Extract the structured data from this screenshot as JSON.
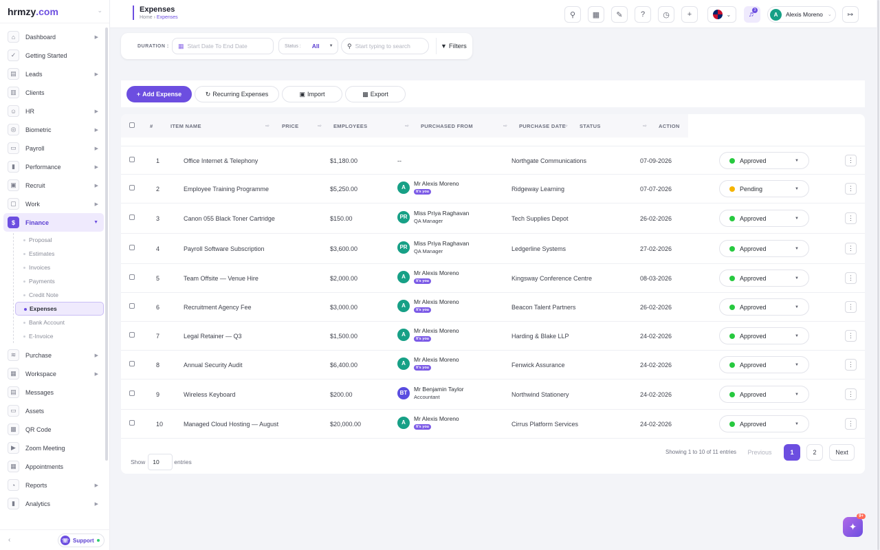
{
  "app": {
    "logo_text": "hrmzy",
    "logo_suffix": ".com"
  },
  "sidebar": {
    "items": [
      {
        "label": "Dashboard",
        "icon": "home-icon",
        "arrow": true
      },
      {
        "label": "Getting Started",
        "icon": "check-circle-icon",
        "arrow": false
      },
      {
        "label": "Leads",
        "icon": "id-card-icon",
        "arrow": true
      },
      {
        "label": "Clients",
        "icon": "building-icon",
        "arrow": false
      },
      {
        "label": "HR",
        "icon": "users-icon",
        "arrow": true
      },
      {
        "label": "Biometric",
        "icon": "fingerprint-icon",
        "arrow": true
      },
      {
        "label": "Payroll",
        "icon": "wallet-icon",
        "arrow": true
      },
      {
        "label": "Performance",
        "icon": "bar-chart-icon",
        "arrow": true
      },
      {
        "label": "Recruit",
        "icon": "briefcase-icon",
        "arrow": true
      },
      {
        "label": "Work",
        "icon": "suitcase-icon",
        "arrow": true
      },
      {
        "label": "Finance",
        "icon": "dollar-icon",
        "arrow": true,
        "active": true
      }
    ],
    "finance_sub": [
      "Proposal",
      "Estimates",
      "Invoices",
      "Payments",
      "Credit Note",
      "Expenses",
      "Bank Account",
      "E-Invoice"
    ],
    "finance_active": "Expenses",
    "items_after": [
      {
        "label": "Purchase",
        "icon": "layers-icon",
        "arrow": true
      },
      {
        "label": "Workspace",
        "icon": "grid-icon",
        "arrow": true
      },
      {
        "label": "Messages",
        "icon": "message-icon",
        "arrow": false
      },
      {
        "label": "Assets",
        "icon": "monitor-icon",
        "arrow": false
      },
      {
        "label": "QR Code",
        "icon": "qr-code-icon",
        "arrow": false
      },
      {
        "label": "Zoom Meeting",
        "icon": "video-icon",
        "arrow": false
      },
      {
        "label": "Appointments",
        "icon": "calendar-check-icon",
        "arrow": false
      },
      {
        "label": "Reports",
        "icon": "pie-chart-icon",
        "arrow": true
      },
      {
        "label": "Analytics",
        "icon": "analytics-icon",
        "arrow": true
      }
    ],
    "support_label": "Support"
  },
  "header": {
    "title": "Expenses",
    "breadcrumb": {
      "home": "Home",
      "current": "Expenses"
    },
    "user_initial": "A",
    "user_name": "Alexis Moreno",
    "notification_count": "3"
  },
  "filters": {
    "duration_label": "DURATION :",
    "date_placeholder": "Start Date To End Date",
    "status_label": "Status :",
    "status_value": "All",
    "search_placeholder": "Start typing to search",
    "filters_label": "Filters"
  },
  "actions": {
    "add": "Add Expense",
    "recurring": "Recurring Expenses",
    "import": "Import",
    "export": "Export"
  },
  "table": {
    "columns": [
      "#",
      "ITEM NAME",
      "PRICE",
      "EMPLOYEES",
      "PURCHASED FROM",
      "PURCHASE DATE",
      "STATUS",
      "ACTION"
    ],
    "rows": [
      {
        "num": "1",
        "item": "Office Internet & Telephony",
        "price": "$1,180.00",
        "emp": null,
        "vendor": "Northgate Communications",
        "date": "07-09-2026",
        "status": "Approved"
      },
      {
        "num": "2",
        "item": "Employee Training Programme",
        "price": "$5,250.00",
        "emp": {
          "initials": "A",
          "name": "Mr Alexis Moreno",
          "tag": "It's you",
          "color": "#17a086"
        },
        "vendor": "Ridgeway Learning",
        "date": "07-07-2026",
        "status": "Pending"
      },
      {
        "num": "3",
        "item": "Canon 055 Black Toner Cartridge",
        "price": "$150.00",
        "emp": {
          "initials": "PR",
          "name": "Miss Priya Raghavan",
          "sub": "QA Manager",
          "color": "#17a086"
        },
        "vendor": "Tech Supplies Depot",
        "date": "26-02-2026",
        "status": "Approved"
      },
      {
        "num": "4",
        "item": "Payroll Software Subscription",
        "price": "$3,600.00",
        "emp": {
          "initials": "PR",
          "name": "Miss Priya Raghavan",
          "sub": "QA Manager",
          "color": "#17a086"
        },
        "vendor": "Ledgerline Systems",
        "date": "27-02-2026",
        "status": "Approved"
      },
      {
        "num": "5",
        "item": "Team Offsite — Venue Hire",
        "price": "$2,000.00",
        "emp": {
          "initials": "A",
          "name": "Mr Alexis Moreno",
          "tag": "It's you",
          "color": "#17a086"
        },
        "vendor": "Kingsway Conference Centre",
        "date": "08-03-2026",
        "status": "Approved"
      },
      {
        "num": "6",
        "item": "Recruitment Agency Fee",
        "price": "$3,000.00",
        "emp": {
          "initials": "A",
          "name": "Mr Alexis Moreno",
          "tag": "It's you",
          "color": "#17a086"
        },
        "vendor": "Beacon Talent Partners",
        "date": "26-02-2026",
        "status": "Approved"
      },
      {
        "num": "7",
        "item": "Legal Retainer — Q3",
        "price": "$1,500.00",
        "emp": {
          "initials": "A",
          "name": "Mr Alexis Moreno",
          "tag": "It's you",
          "color": "#17a086"
        },
        "vendor": "Harding & Blake LLP",
        "date": "24-02-2026",
        "status": "Approved"
      },
      {
        "num": "8",
        "item": "Annual Security Audit",
        "price": "$6,400.00",
        "emp": {
          "initials": "A",
          "name": "Mr Alexis Moreno",
          "tag": "It's you",
          "color": "#17a086"
        },
        "vendor": "Fenwick Assurance",
        "date": "24-02-2026",
        "status": "Approved"
      },
      {
        "num": "9",
        "item": "Wireless Keyboard",
        "price": "$200.00",
        "emp": {
          "initials": "BT",
          "name": "Mr Benjamin Taylor",
          "sub": "Accountant",
          "color": "#5a4de0"
        },
        "vendor": "Northwind Stationery",
        "date": "24-02-2026",
        "status": "Approved"
      },
      {
        "num": "10",
        "item": "Managed Cloud Hosting — August",
        "price": "$20,000.00",
        "emp": {
          "initials": "A",
          "name": "Mr Alexis Moreno",
          "tag": "It's you",
          "color": "#17a086"
        },
        "vendor": "Cirrus Platform Services",
        "date": "24-02-2026",
        "status": "Approved"
      }
    ],
    "empty_employee": "--"
  },
  "footer": {
    "show_label": "Show",
    "entries_value": "10",
    "entries_label": "entries",
    "showing_text": "Showing 1 to 10 of 11 entries",
    "prev": "Previous",
    "pages": [
      "1",
      "2"
    ],
    "current_page": "1",
    "next": "Next"
  },
  "fab_badge": "9+",
  "colors": {
    "accent": "#6c4ee0",
    "approved": "#27c93f",
    "pending": "#f5b400"
  }
}
